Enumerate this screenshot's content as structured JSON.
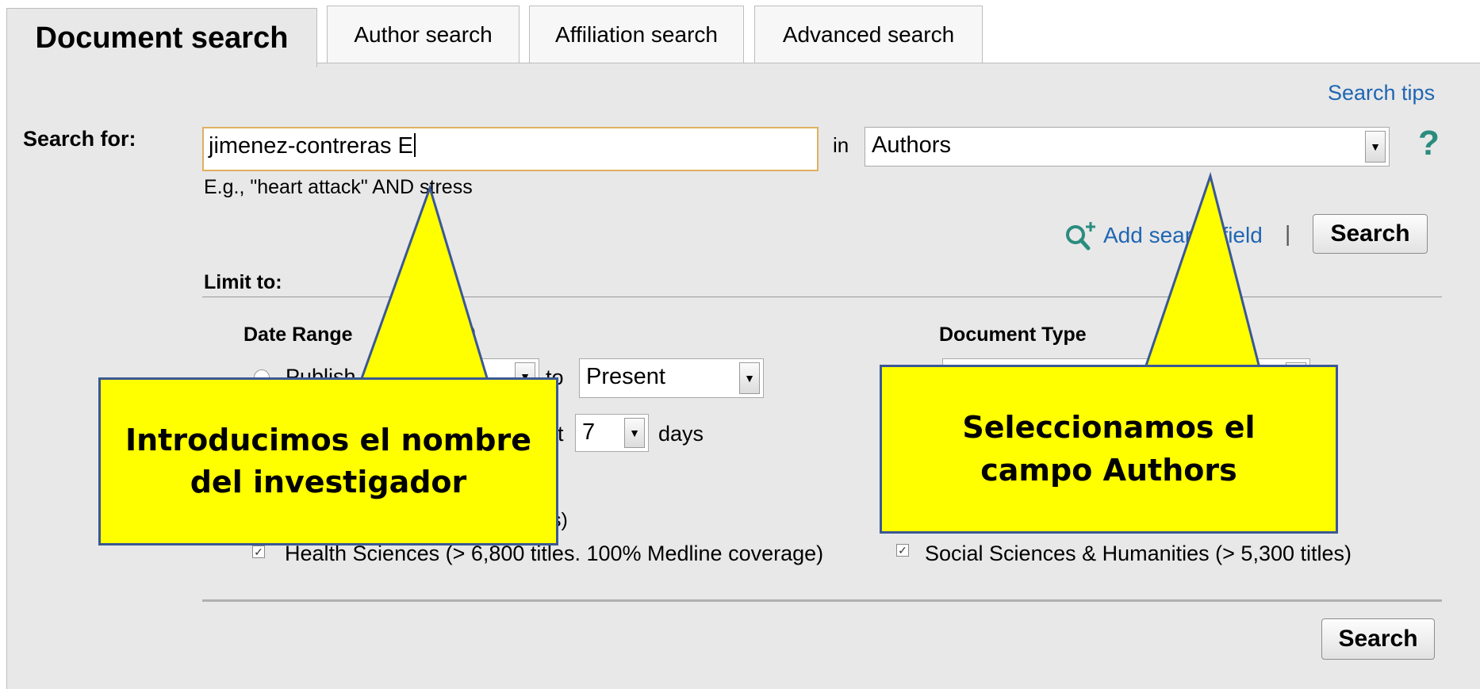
{
  "tabs": [
    "Document search",
    "Author search",
    "Affiliation search",
    "Advanced search"
  ],
  "search_tips": "Search tips",
  "search_for_label": "Search for:",
  "search_value": "jimenez-contreras E",
  "example_hint": "E.g., \"heart attack\" AND stress",
  "in_label": "in",
  "field_select": "Authors",
  "help_symbol": "?",
  "add_search_field": "Add search field",
  "separator": "|",
  "search_button": "Search",
  "limit_to": "Limit to:",
  "date_range_label": "Date Range",
  "date_range_suffix": ")",
  "published_label": "Publish",
  "to_label": "to",
  "to_value": "Present",
  "last_fragment": "t",
  "last_days_value": "7",
  "days_label": "days",
  "subject_fragment": "s)",
  "document_type_label": "Document Type",
  "subject_areas": [
    {
      "label": "Health Sciences (> 6,800 titles. 100% Medline coverage)",
      "checked": true
    },
    {
      "label": "Social Sciences & Humanities (> 5,300 titles)",
      "checked": true
    }
  ],
  "callouts": {
    "left": "Introducimos el nombre del investigador",
    "right": "Seleccionamos el campo Authors"
  },
  "colors": {
    "callout_fill": "#ffff00",
    "callout_border": "#3b5894",
    "link": "#1f66b3",
    "help": "#2b8c7e"
  }
}
